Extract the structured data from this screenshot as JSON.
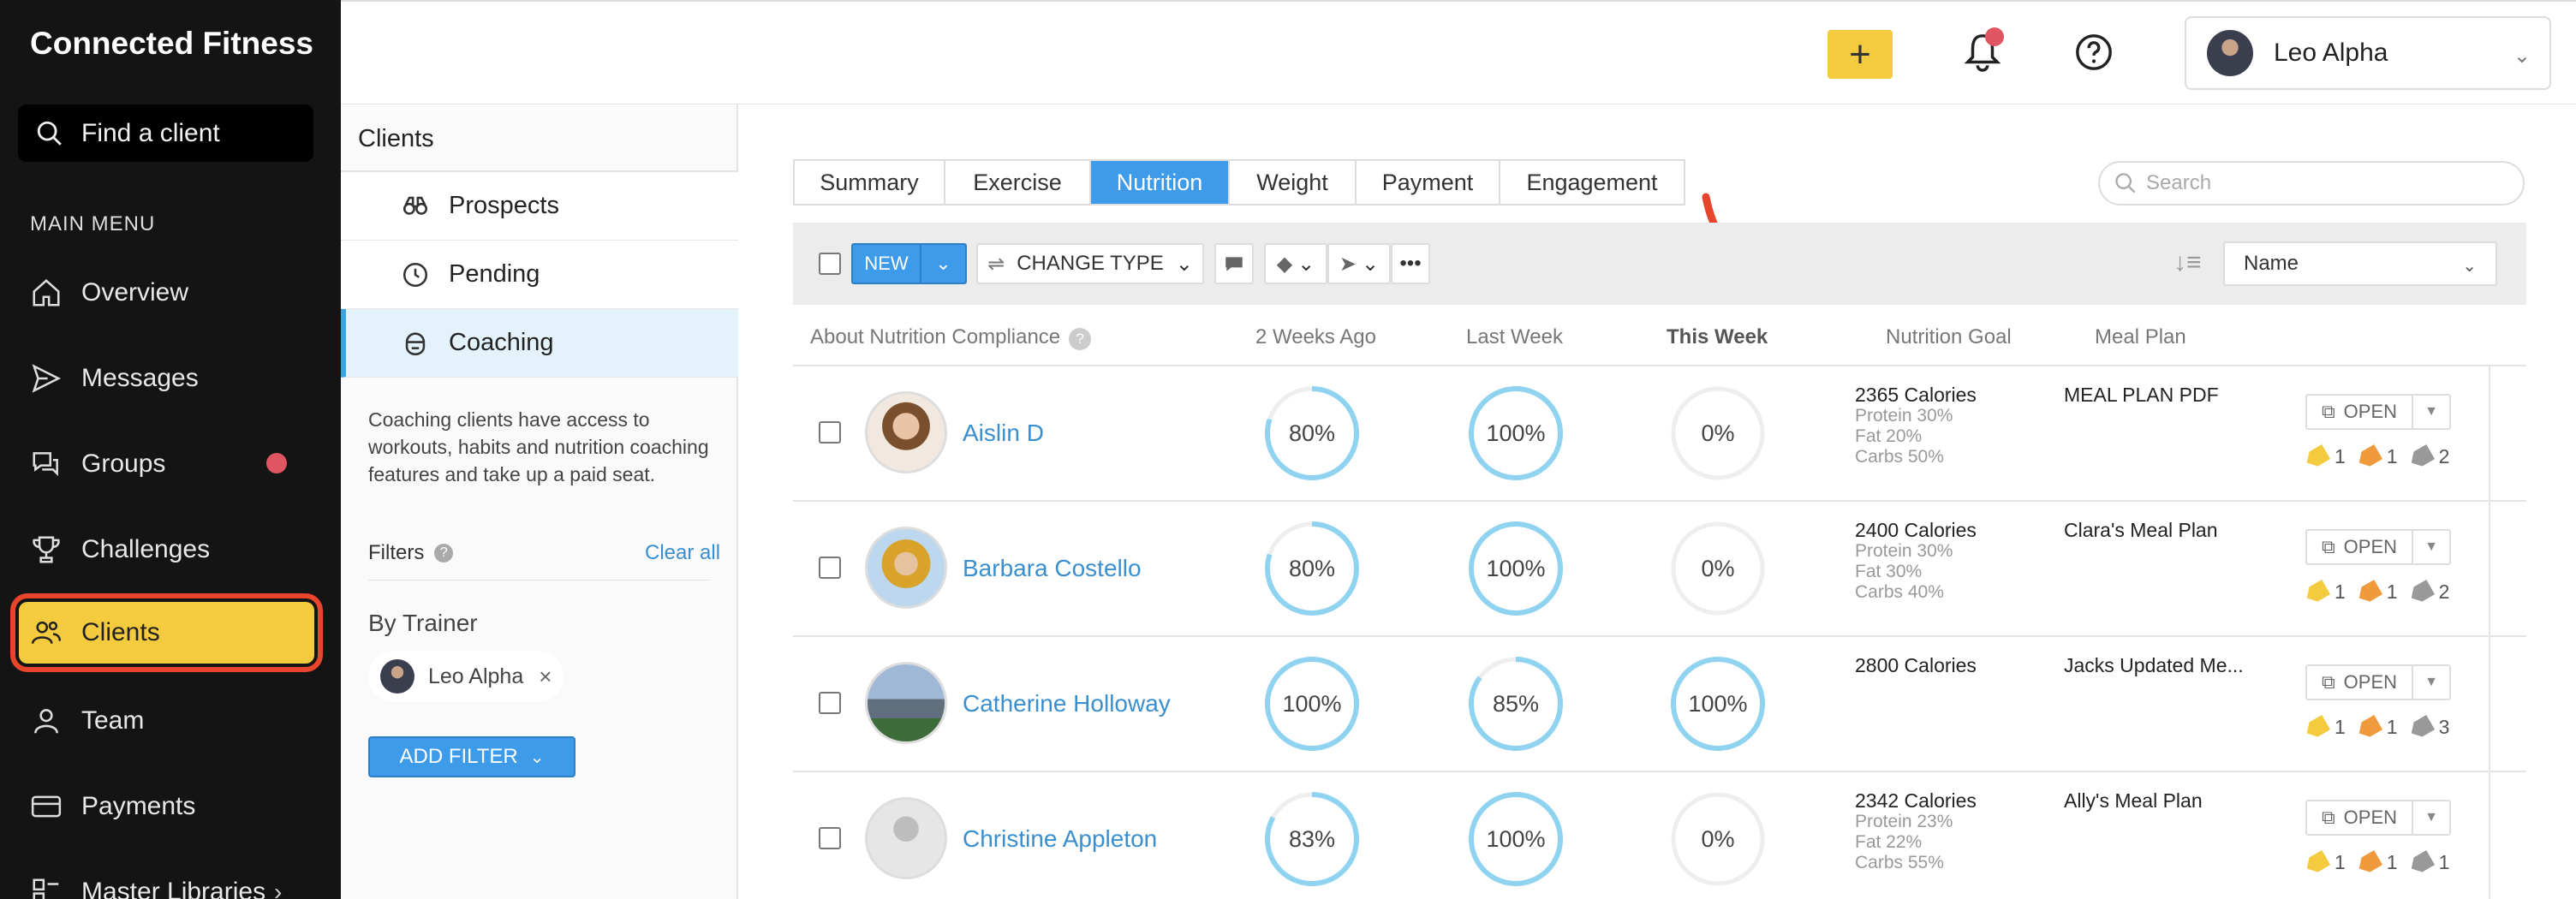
{
  "app": {
    "title": "Connected Fitness"
  },
  "sidebar": {
    "search_label": "Find a client",
    "menu_heading": "MAIN MENU",
    "items": [
      {
        "label": "Overview",
        "icon": "home-icon"
      },
      {
        "label": "Messages",
        "icon": "send-icon"
      },
      {
        "label": "Groups",
        "icon": "chat-icon"
      },
      {
        "label": "Challenges",
        "icon": "trophy-icon"
      },
      {
        "label": "Clients",
        "icon": "people-icon"
      },
      {
        "label": "Team",
        "icon": "person-icon"
      },
      {
        "label": "Payments",
        "icon": "card-icon"
      },
      {
        "label": "Master Libraries",
        "icon": "library-icon"
      }
    ],
    "active_item": "Clients",
    "notification_color": "#e05562",
    "active_color": "#f4cb3f"
  },
  "header": {
    "add_label": "+",
    "user_name": "Leo Alpha"
  },
  "panel": {
    "title": "Clients",
    "items": [
      {
        "label": "Prospects"
      },
      {
        "label": "Pending"
      },
      {
        "label": "Coaching"
      }
    ],
    "active_item": "Coaching",
    "description": "Coaching clients have access to workouts, habits and nutrition coaching features and take up a paid seat.",
    "filters_label": "Filters",
    "clear_all": "Clear all",
    "by_trainer": "By Trainer",
    "trainer_chip": "Leo Alpha",
    "chip_remove": "×",
    "add_filter": "ADD FILTER"
  },
  "tabs": [
    {
      "label": "Summary"
    },
    {
      "label": "Exercise"
    },
    {
      "label": "Nutrition"
    },
    {
      "label": "Weight"
    },
    {
      "label": "Payment"
    },
    {
      "label": "Engagement"
    }
  ],
  "active_tab": "Nutrition",
  "search": {
    "placeholder": "Search"
  },
  "toolbar": {
    "new_label": "NEW",
    "change_type_label": "CHANGE TYPE",
    "sort_value": "Name"
  },
  "columns": {
    "compliance": "About Nutrition Compliance",
    "help": "?",
    "two_weeks": "2 Weeks Ago",
    "last_week": "Last Week",
    "this_week": "This Week",
    "goal": "Nutrition Goal",
    "meal_plan": "Meal Plan"
  },
  "clients": [
    {
      "name": "Aislin D",
      "two_weeks": "80%",
      "two_weeks_val": 0.8,
      "last_week": "100%",
      "last_week_val": 1.0,
      "this_week": "0%",
      "this_week_val": 0.0,
      "calories": "2365 Calories",
      "protein": "Protein 30%",
      "fat": "Fat 20%",
      "carbs": "Carbs 50%",
      "meal_plan": "MEAL PLAN PDF",
      "open_label": "OPEN",
      "tags": [
        "1",
        "1",
        "2"
      ]
    },
    {
      "name": "Barbara Costello",
      "two_weeks": "80%",
      "two_weeks_val": 0.8,
      "last_week": "100%",
      "last_week_val": 1.0,
      "this_week": "0%",
      "this_week_val": 0.0,
      "calories": "2400 Calories",
      "protein": "Protein 30%",
      "fat": "Fat 30%",
      "carbs": "Carbs 40%",
      "meal_plan": "Clara's Meal Plan",
      "open_label": "OPEN",
      "tags": [
        "1",
        "1",
        "2"
      ]
    },
    {
      "name": "Catherine Holloway",
      "two_weeks": "100%",
      "two_weeks_val": 1.0,
      "last_week": "85%",
      "last_week_val": 0.85,
      "this_week": "100%",
      "this_week_val": 1.0,
      "calories": "2800 Calories",
      "protein": "",
      "fat": "",
      "carbs": "",
      "meal_plan": "Jacks Updated Me...",
      "open_label": "OPEN",
      "tags": [
        "1",
        "1",
        "3"
      ]
    },
    {
      "name": "Christine Appleton",
      "two_weeks": "83%",
      "two_weeks_val": 0.83,
      "last_week": "100%",
      "last_week_val": 1.0,
      "this_week": "0%",
      "this_week_val": 0.0,
      "calories": "2342 Calories",
      "protein": "Protein 23%",
      "fat": "Fat 22%",
      "carbs": "Carbs 55%",
      "meal_plan": "Ally's Meal Plan",
      "open_label": "OPEN",
      "tags": [
        "1",
        "1",
        "1"
      ]
    }
  ],
  "colors": {
    "accent": "#3d9be9",
    "ring": "#8fd3f0",
    "ring_track": "#eeeeee",
    "arrow": "#e9452c",
    "tag_yellow": "#f4cb3f",
    "tag_orange": "#f09a3e",
    "tag_gray": "#999999"
  }
}
